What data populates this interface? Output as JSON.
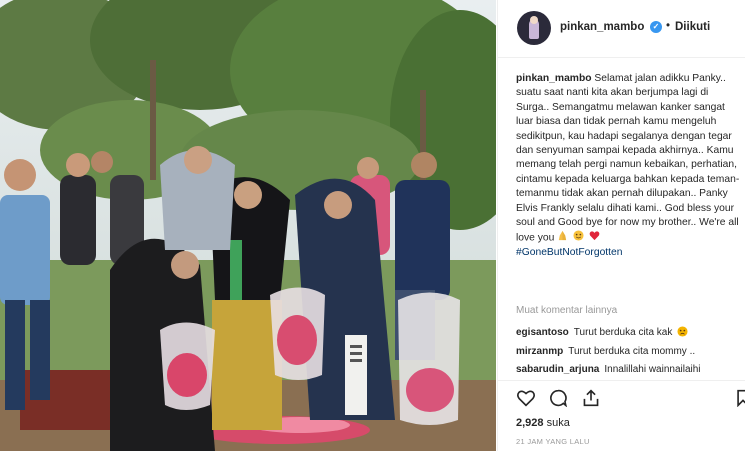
{
  "post": {
    "username": "pinkan_mambo",
    "verified": true,
    "follow_dot": "•",
    "follow_status": "Diikuti"
  },
  "caption": {
    "username": "pinkan_mambo",
    "text": "Selamat jalan adikku Panky.. suatu saat nanti kita akan berjumpa lagi di Surga.. Semangatmu melawan kanker sangat luar biasa dan tidak pernah kamu mengeluh sedikitpun, kau hadapi segalanya dengan tegar dan senyuman sampai kepada akhirnya.. Kamu memang telah pergi namun kebaikan, perhatian, cintamu kepada keluarga bahkan kepada teman-temanmu tidak akan pernah dilupakan.. Panky Elvis Frankly selalu dihati kami.. God bless your soul and Good bye for now my brother.. We're all love you",
    "emojis": [
      "folded-hands-emoji",
      "smiling-face-emoji",
      "red-heart-emoji"
    ],
    "hashtag": "#GoneButNotForgotten"
  },
  "comments_link": "Muat komentar lainnya",
  "comments": [
    {
      "user": "egisantoso",
      "text": "Turut berduka cita kak",
      "emoji": "sad-face-emoji"
    },
    {
      "user": "mirzanmp",
      "text": "Turut berduka cita mommy .."
    },
    {
      "user": "sabarudin_arjuna",
      "text": "Innalillahi wainnailaihi"
    }
  ],
  "stats": {
    "likes_count": "2,928",
    "likes_word": "suka",
    "timestamp": "21 JAM YANG LALU"
  },
  "icons": [
    "heart-icon",
    "comment-icon",
    "share-icon",
    "bookmark-icon",
    "verified-badge-icon"
  ],
  "colors": {
    "verified": "#3897f0",
    "hashtag": "#003569",
    "muted": "#999999",
    "text": "#262626"
  }
}
